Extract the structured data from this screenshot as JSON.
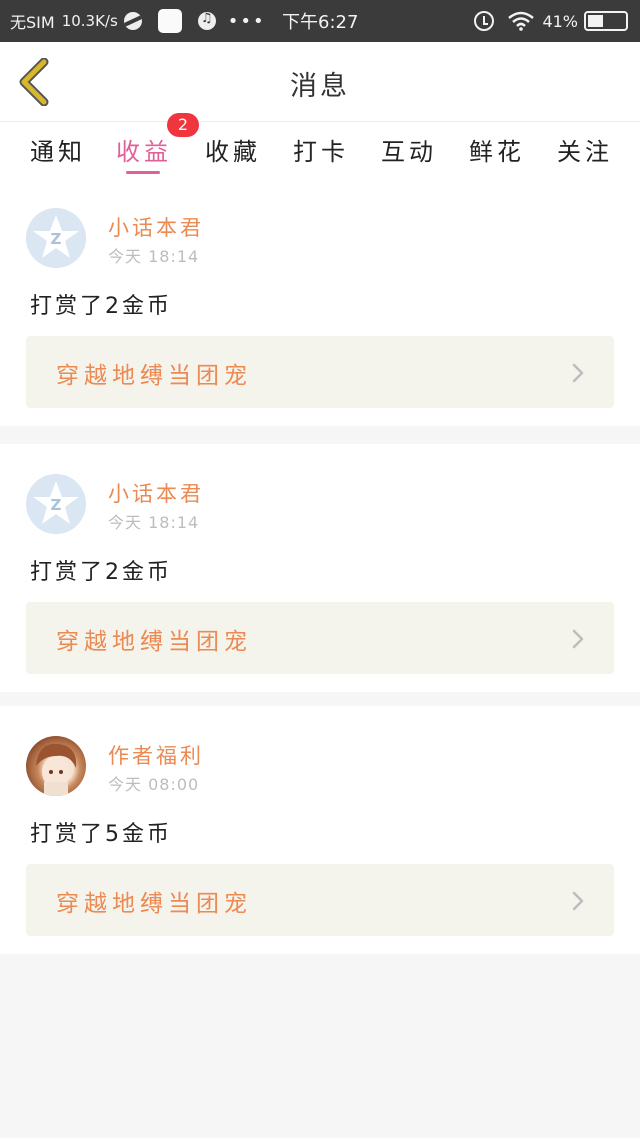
{
  "status_bar": {
    "carrier": "无SIM",
    "speed": "10.3K/s",
    "dots": "•••",
    "time": "下午6:27",
    "battery_pct_label": "41%",
    "battery_level": 0.41
  },
  "header": {
    "title": "消息",
    "back_icon": "chevron-left-icon"
  },
  "tabs": {
    "items": [
      {
        "label": "通知"
      },
      {
        "label": "收益"
      },
      {
        "label": "收藏"
      },
      {
        "label": "打卡"
      },
      {
        "label": "互动"
      },
      {
        "label": "鲜花"
      },
      {
        "label": "关注"
      }
    ],
    "active_index": 1,
    "badge": "2"
  },
  "messages": [
    {
      "username": "小话本君",
      "time": "今天 18:14",
      "text": "打赏了2金币",
      "link": "穿越地缚当团宠"
    },
    {
      "username": "小话本君",
      "time": "今天 18:14",
      "text": "打赏了2金币",
      "link": "穿越地缚当团宠"
    },
    {
      "username": "作者福利",
      "time": "今天 08:00",
      "text": "打赏了5金币",
      "link": "穿越地缚当团宠"
    }
  ],
  "colors": {
    "accent_pink": "#e2609a",
    "accent_orange": "#eb8a52",
    "badge_red": "#f0353f",
    "back_yellow": "#d8b72a"
  }
}
